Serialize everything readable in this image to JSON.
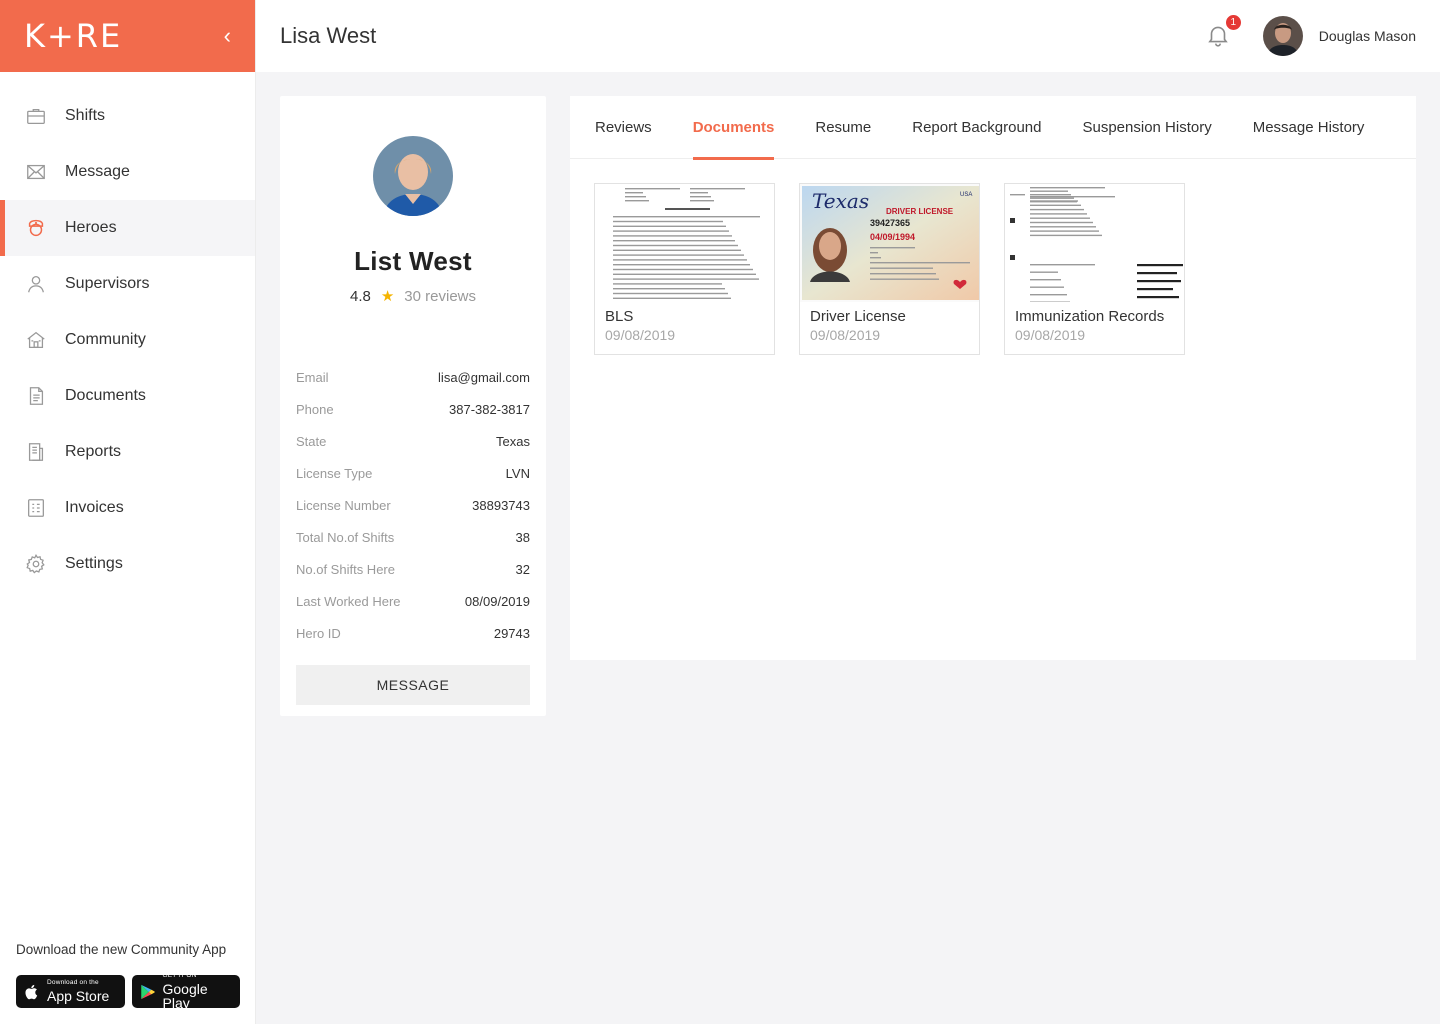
{
  "brand": {
    "logo": "K+RE"
  },
  "nav": [
    {
      "key": "shifts",
      "label": "Shifts",
      "icon": "briefcase-icon",
      "active": false
    },
    {
      "key": "message",
      "label": "Message",
      "icon": "mail-icon",
      "active": false
    },
    {
      "key": "heroes",
      "label": "Heroes",
      "icon": "nurse-icon",
      "active": true
    },
    {
      "key": "supervisors",
      "label": "Supervisors",
      "icon": "person-icon",
      "active": false
    },
    {
      "key": "community",
      "label": "Community",
      "icon": "building-icon",
      "active": false
    },
    {
      "key": "documents",
      "label": "Documents",
      "icon": "document-icon",
      "active": false
    },
    {
      "key": "reports",
      "label": "Reports",
      "icon": "report-icon",
      "active": false
    },
    {
      "key": "invoices",
      "label": "Invoices",
      "icon": "invoice-icon",
      "active": false
    },
    {
      "key": "settings",
      "label": "Settings",
      "icon": "gear-icon",
      "active": false
    }
  ],
  "download": {
    "text": "Download the new Community App",
    "appstore_small": "Download on the",
    "appstore_big": "App Store",
    "googleplay_small": "GET IT ON",
    "googleplay_big": "Google Play"
  },
  "header": {
    "title": "Lisa West",
    "notification_count": "1",
    "user_name": "Douglas Mason"
  },
  "profile": {
    "name": "List West",
    "rating": "4.8",
    "reviews": "30 reviews",
    "fields": [
      {
        "label": "Email",
        "value": "lisa@gmail.com"
      },
      {
        "label": "Phone",
        "value": "387-382-3817"
      },
      {
        "label": "State",
        "value": "Texas"
      },
      {
        "label": "License Type",
        "value": "LVN"
      },
      {
        "label": "License Number",
        "value": "38893743"
      },
      {
        "label": "Total No.of Shifts",
        "value": "38"
      },
      {
        "label": "No.of Shifts Here",
        "value": "32"
      },
      {
        "label": "Last Worked Here",
        "value": "08/09/2019"
      },
      {
        "label": "Hero ID",
        "value": "29743"
      }
    ],
    "message_button": "MESSAGE"
  },
  "tabs": [
    {
      "label": "Reviews",
      "active": false
    },
    {
      "label": "Documents",
      "active": true
    },
    {
      "label": "Resume",
      "active": false
    },
    {
      "label": "Report Background",
      "active": false
    },
    {
      "label": "Suspension History",
      "active": false
    },
    {
      "label": "Message History",
      "active": false
    }
  ],
  "documents": [
    {
      "name": "BLS",
      "date": "09/08/2019",
      "thumb": "resume"
    },
    {
      "name": "Driver License",
      "date": "09/08/2019",
      "thumb": "license"
    },
    {
      "name": "Immunization Records",
      "date": "09/08/2019",
      "thumb": "records"
    }
  ],
  "license_thumb": {
    "state": "Texas",
    "title": "DRIVER LICENSE",
    "country": "USA",
    "dl_number": "39427365",
    "dob": "04/09/1994"
  },
  "colors": {
    "accent": "#f26b4c",
    "badge": "#e53935",
    "star": "#f5b400"
  }
}
